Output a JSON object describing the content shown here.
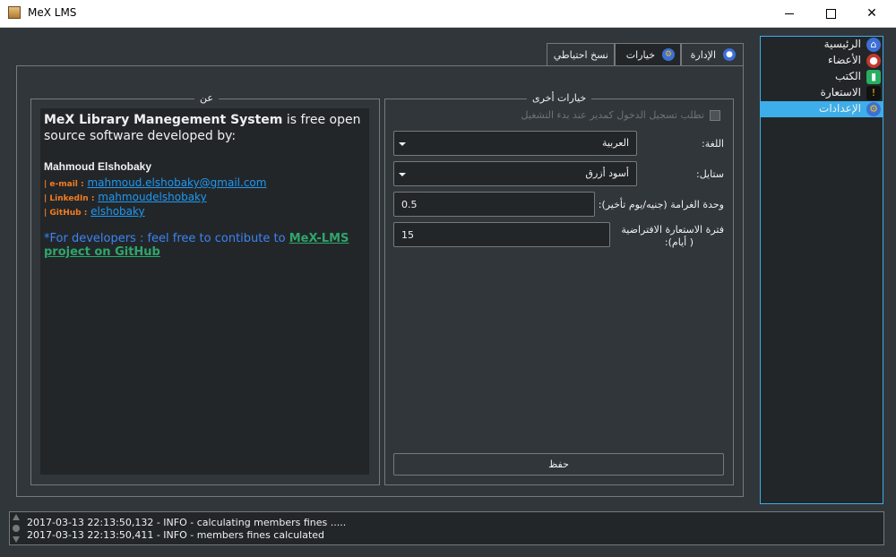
{
  "window": {
    "title": "MeX LMS",
    "icon": "app-book-icon"
  },
  "sidebar": {
    "items": [
      {
        "label": "الرئيسية",
        "icon": "home-icon",
        "active": false
      },
      {
        "label": "الأعضاء",
        "icon": "members-icon",
        "active": false
      },
      {
        "label": "الكتب",
        "icon": "book-icon",
        "active": false
      },
      {
        "label": "الاستعارة",
        "icon": "borrow-icon",
        "active": false
      },
      {
        "label": "الإعدادات",
        "icon": "settings-icon",
        "active": true
      }
    ]
  },
  "tabs": [
    {
      "label": "الإدارة",
      "icon": "user-icon",
      "selected": false
    },
    {
      "label": "خيارات",
      "icon": "options-icon",
      "selected": true
    },
    {
      "label": "نسخ احتياطي",
      "selected": false
    }
  ],
  "about": {
    "group_title": "عن",
    "app_name": "MeX Library Manegement System",
    "intro_rest": " is free open source software developed by:",
    "developer": "Mahmoud Elshobaky",
    "contacts": [
      {
        "label": "| e-mail :",
        "value": "mahmoud.elshobaky@gmail.com"
      },
      {
        "label": "| LinkedIn :",
        "value": "mahmoudelshobaky"
      },
      {
        "label": "| GitHub :",
        "value": "elshobaky"
      }
    ],
    "note_prefix": "*For developers : feel free to contibute to ",
    "note_link": "MeX-LMS project on GitHub"
  },
  "options": {
    "group_title": "خيارات أخرى",
    "checkbox_label": "تطلب تسجيل الدخول كمدير عند بدء التشغيل",
    "checkbox_checked": false,
    "language_label": "اللغة:",
    "language_value": "العربية",
    "style_label": "ستايل:",
    "style_value": "أسود أزرق",
    "fine_label": "وحدة الغرامة (جنيه/يوم تأخير):",
    "fine_value": "0.5",
    "loan_label_line1": "فترة الاستعارة الافتراضية",
    "loan_label_line2": "( أيام):",
    "loan_value": "15",
    "save_label": "حفظ"
  },
  "log": [
    "2017-03-13 22:13:50,132 - INFO - calculating members fines .....",
    "2017-03-13 22:13:50,411 - INFO - members fines calculated"
  ],
  "colors": {
    "accent": "#3daee9",
    "background": "#31363b",
    "surface": "#232629",
    "border": "#76797c"
  }
}
